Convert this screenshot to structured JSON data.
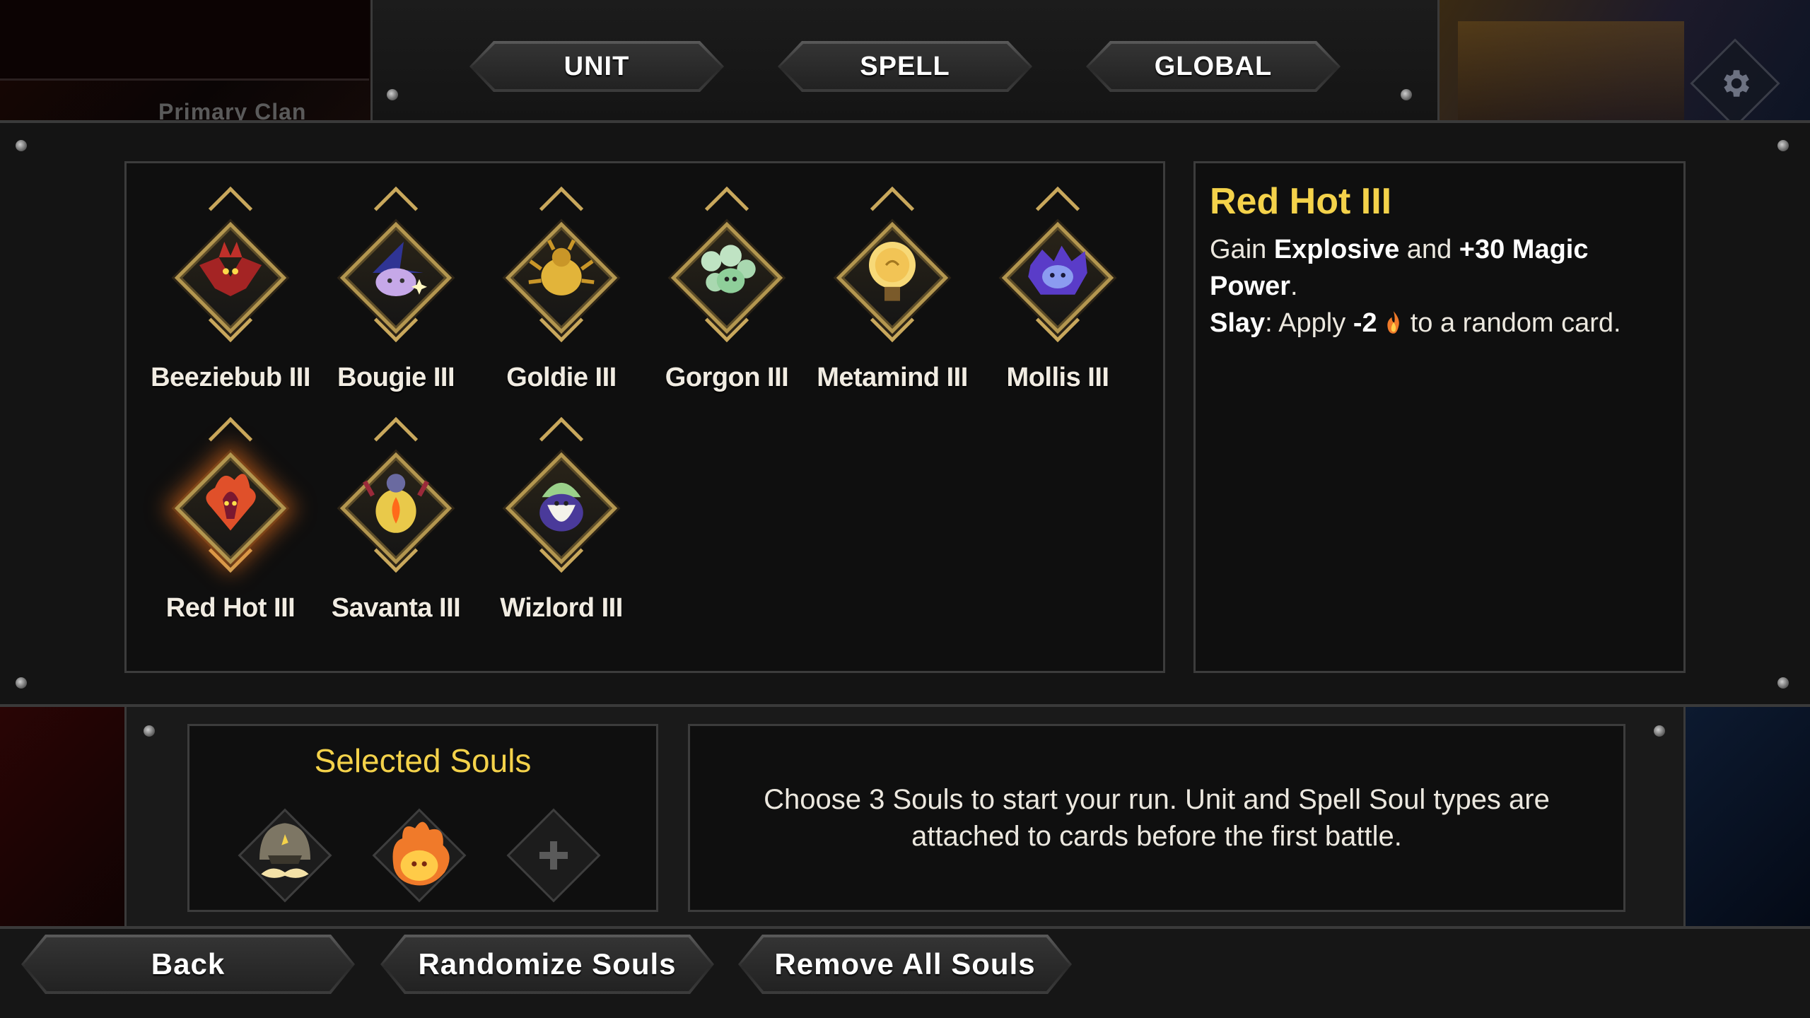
{
  "header": {
    "clan_label": "Primary Clan",
    "tabs": [
      {
        "label": "UNIT"
      },
      {
        "label": "SPELL"
      },
      {
        "label": "GLOBAL"
      }
    ]
  },
  "souls": [
    {
      "name": "Beeziebub III",
      "icon": "bat-demon-icon",
      "color": "#c0302a"
    },
    {
      "name": "Bougie III",
      "icon": "witch-hat-icon",
      "color": "#3a3fb0"
    },
    {
      "name": "Goldie III",
      "icon": "golden-beetle-icon",
      "color": "#e2b43a"
    },
    {
      "name": "Gorgon III",
      "icon": "gorgon-icon",
      "color": "#9bd0a4"
    },
    {
      "name": "Metamind III",
      "icon": "brain-lamp-icon",
      "color": "#f2c455"
    },
    {
      "name": "Mollis III",
      "icon": "purple-blob-icon",
      "color": "#6a48d8"
    },
    {
      "name": "Red Hot III",
      "icon": "fire-imp-icon",
      "color": "#e0502a",
      "selected": true
    },
    {
      "name": "Savanta III",
      "icon": "lantern-creature-icon",
      "color": "#f0a030"
    },
    {
      "name": "Wizlord III",
      "icon": "wizard-icon",
      "color": "#8a7ad0"
    }
  ],
  "detail": {
    "title": "Red Hot III",
    "line1_prefix": "Gain ",
    "line1_bold1": "Explosive",
    "line1_mid": " and ",
    "line1_bold2": "+30 Magic Power",
    "line1_suffix": ".",
    "line2_bold1": "Slay",
    "line2_mid": ": Apply ",
    "line2_bold2": "-2",
    "line2_suffix": " to a random card."
  },
  "selected": {
    "title": "Selected Souls",
    "slots": [
      {
        "icon": "helmet-mustache-icon"
      },
      {
        "icon": "fire-blob-icon"
      },
      {
        "icon": "add-icon",
        "empty": true
      }
    ]
  },
  "info": {
    "text": "Choose 3 Souls to start your run. Unit and Spell Soul types are attached to cards before the first battle."
  },
  "footer": {
    "back": "Back",
    "randomize": "Randomize Souls",
    "remove": "Remove All Souls"
  },
  "colors": {
    "gold": "#f4d24a",
    "frame_gold": "#b3964f",
    "panel_bg": "#0f0f0f",
    "border": "#3c3c3c"
  }
}
